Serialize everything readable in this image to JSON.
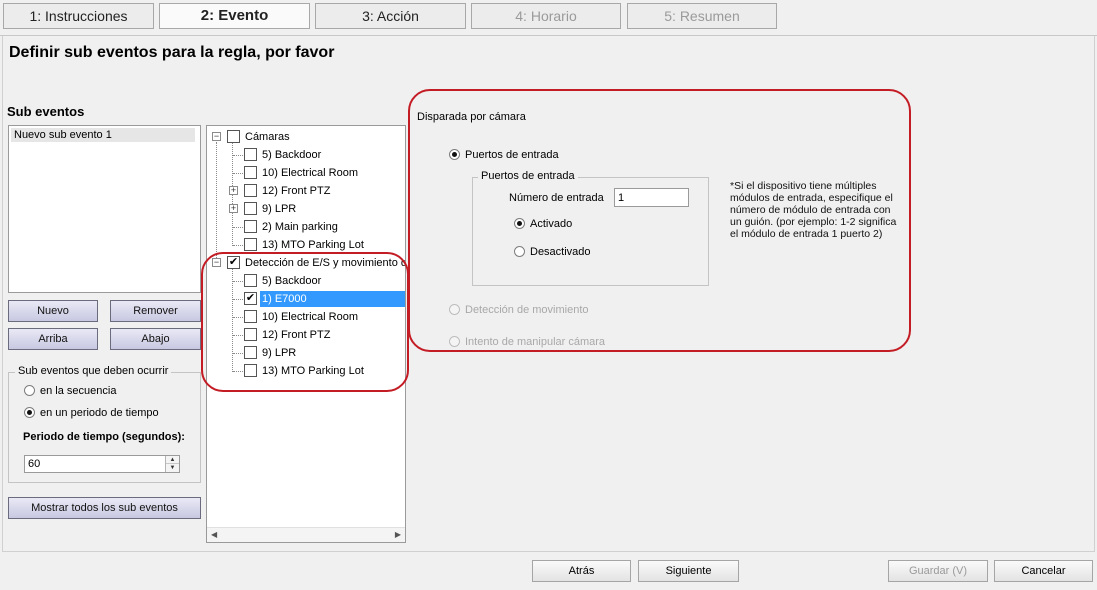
{
  "tabs": [
    {
      "label": "1: Instrucciones"
    },
    {
      "label": "2: Evento"
    },
    {
      "label": "3: Acción"
    },
    {
      "label": "4: Horario"
    },
    {
      "label": "5: Resumen"
    }
  ],
  "page_title": "Definir sub eventos para la regla, por favor",
  "sub_events": {
    "heading": "Sub eventos",
    "items": [
      "Nuevo sub evento 1"
    ],
    "buttons": {
      "new": "Nuevo",
      "remove": "Remover",
      "up": "Arriba",
      "down": "Abajo"
    },
    "occurrence": {
      "title": "Sub eventos que deben ocurrir",
      "option_sequence": "en la secuencia",
      "option_period": "en un periodo de tiempo",
      "selected": "period",
      "period_label": "Periodo de tiempo (segundos):",
      "period_value": "60"
    },
    "show_all_label": "Mostrar todos los sub eventos"
  },
  "tree": {
    "root_cameras": "Cámaras",
    "cameras": [
      "5) Backdoor",
      "10) Electrical Room",
      "12) Front PTZ",
      "9) LPR",
      "2) Main parking",
      "13) MTO Parking Lot"
    ],
    "root_io": "Detección de E/S y movimiento d",
    "io": [
      "5) Backdoor",
      "1) E7000",
      "10) Electrical Room",
      "12) Front PTZ",
      "9) LPR",
      "13) MTO Parking Lot"
    ],
    "selected_io": "1) E7000"
  },
  "trigger": {
    "title": "Disparada por cámara",
    "option_inputs": "Puertos de entrada",
    "inputs_group_title": "Puertos de entrada",
    "entry_number_label": "Número de entrada",
    "entry_number_value": "1",
    "activated": "Activado",
    "deactivated": "Desactivado",
    "hint": "*Si el dispositivo tiene múltiples módulos de entrada, especifique el número de módulo de entrada con un guión. (por ejemplo: 1-2 significa el módulo de entrada 1 puerto 2)",
    "option_motion": "Detección de movimiento",
    "option_tamper": "Intento de manipular cámara"
  },
  "footer": {
    "back": "Atrás",
    "next": "Siguiente",
    "save": "Guardar (V)",
    "cancel": "Cancelar"
  },
  "colors": {
    "annotation": "#c41c24",
    "selection": "#3399ff"
  }
}
